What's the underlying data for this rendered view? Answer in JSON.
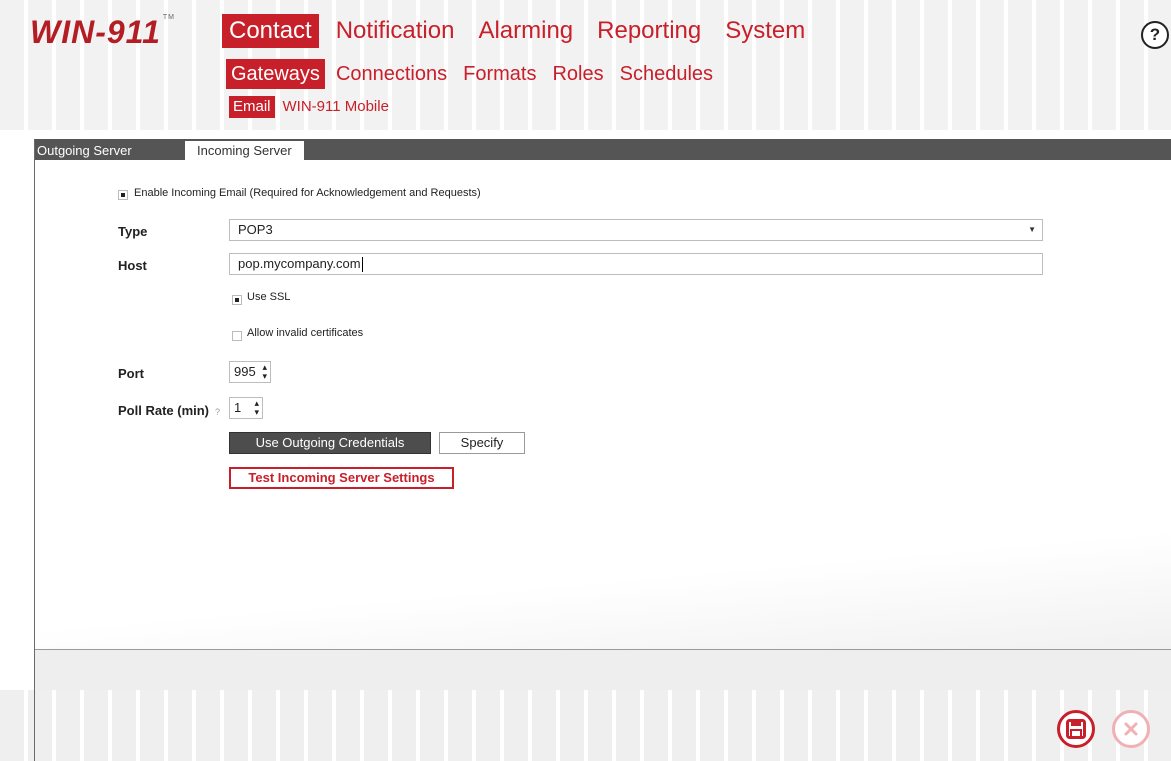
{
  "app": {
    "logo_text": "WIN-911",
    "logo_tm": "TM",
    "help_label": "?"
  },
  "nav_primary": [
    "Contact",
    "Notification",
    "Alarming",
    "Reporting",
    "System"
  ],
  "nav_secondary": [
    "Gateways",
    "Connections",
    "Formats",
    "Roles",
    "Schedules"
  ],
  "nav_tertiary": [
    "Email",
    "WIN-911 Mobile"
  ],
  "tabs": [
    "Outgoing Server",
    "Incoming Server"
  ],
  "form": {
    "enable_label": "Enable Incoming Email (Required for Acknowledgement and Requests)",
    "enable_checked": true,
    "type_label": "Type",
    "type_value": "POP3",
    "host_label": "Host",
    "host_value": "pop.mycompany.com",
    "use_ssl_label": "Use SSL",
    "use_ssl_checked": true,
    "allow_invalid_label": "Allow invalid certificates",
    "allow_invalid_checked": false,
    "port_label": "Port",
    "port_value": "995",
    "poll_label": "Poll Rate (min)",
    "poll_help": "?",
    "poll_value": "1",
    "use_outgoing_label": "Use Outgoing Credentials",
    "specify_label": "Specify",
    "test_label": "Test Incoming Server Settings"
  },
  "colors": {
    "accent": "#c8202b",
    "tabbar": "#555555"
  },
  "icons": {
    "save": "save-icon",
    "cancel": "close-icon",
    "help": "help-icon"
  }
}
